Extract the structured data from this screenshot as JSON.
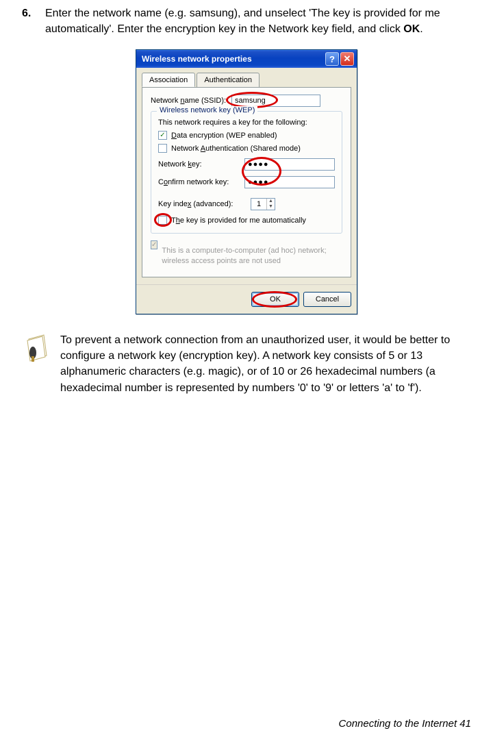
{
  "step": {
    "number": "6.",
    "text_a": "Enter the network name (e.g. samsung), and unselect 'The key is provided for me automatically'. Enter the encryption key in the Network key field, and click ",
    "text_b": "OK",
    "text_c": "."
  },
  "dialog": {
    "title": "Wireless network properties",
    "help": "?",
    "close": "✕",
    "tabs": {
      "association": "Association",
      "authentication": "Authentication"
    },
    "ssid_label_a": "Network ",
    "ssid_label_b": "n",
    "ssid_label_c": "ame (SSID):",
    "ssid_value": "samsung",
    "group_legend": "Wireless network key (WEP)",
    "group_intro": "This network requires a key for the following:",
    "cb_data_a": "D",
    "cb_data_b": "ata encryption (WEP enabled)",
    "cb_auth_a": "Network ",
    "cb_auth_b": "A",
    "cb_auth_c": "uthentication (Shared mode)",
    "netkey_label_a": "Network ",
    "netkey_label_b": "k",
    "netkey_label_c": "ey:",
    "netkey_value": "●●●●",
    "confkey_label_a": "C",
    "confkey_label_b": "o",
    "confkey_label_c": "nfirm network key:",
    "confkey_value": "●●●●",
    "keyindex_label_a": "Key inde",
    "keyindex_label_b": "x",
    "keyindex_label_c": " (advanced):",
    "keyindex_value": "1",
    "cb_auto_a": "T",
    "cb_auto_b": "h",
    "cb_auto_c": "e key is provided for me automatically",
    "adhoc_note": "This is a computer-to-computer (ad hoc) network; wireless access points are not used",
    "ok": "OK",
    "cancel": "Cancel"
  },
  "note": "To prevent a network connection from an unauthorized user, it would be better to configure a network key (encryption key). A network key consists of 5 or 13 alphanumeric characters (e.g. magic), or of 10 or 26 hexadecimal numbers (a hexadecimal number is represented by numbers '0' to '9' or letters 'a' to 'f').",
  "footer": "Connecting to the Internet   41"
}
